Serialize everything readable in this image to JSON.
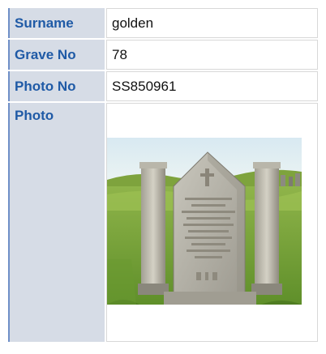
{
  "record": {
    "surname": {
      "label": "Surname",
      "value": "golden"
    },
    "grave_no": {
      "label": "Grave No",
      "value": "78"
    },
    "photo_no": {
      "label": "Photo No",
      "value": "SS850961"
    },
    "photo": {
      "label": "Photo",
      "image_icon": "gravestone-photo"
    }
  },
  "colors": {
    "label_bg": "#d6dce6",
    "label_text": "#1f5aa6",
    "accent_border": "#6f8fc7"
  }
}
